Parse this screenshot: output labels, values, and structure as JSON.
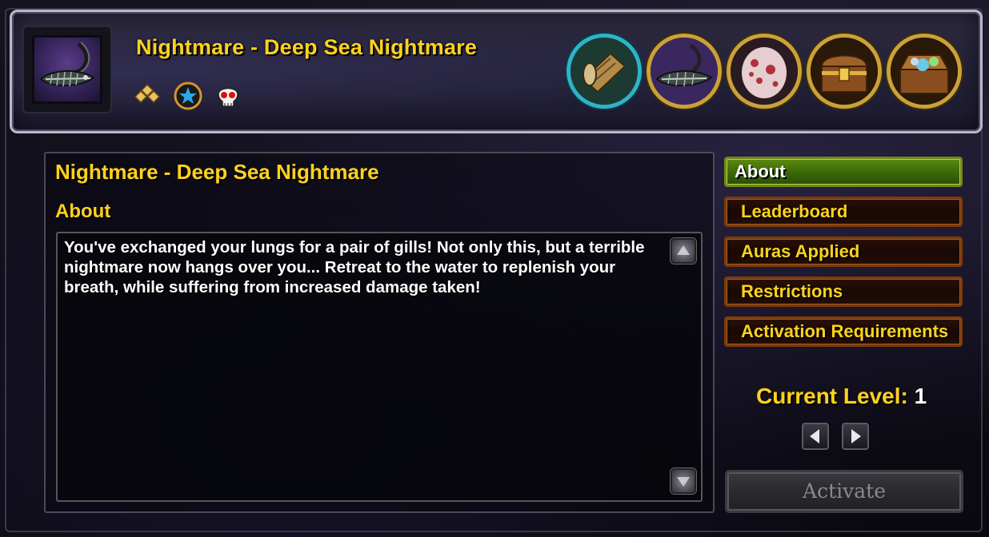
{
  "header": {
    "title": "Nightmare - Deep Sea Nightmare",
    "portrait_icon": "fish-skeleton-icon",
    "badges": [
      "rank-diamonds-icon",
      "blue-star-icon",
      "red-eyed-skull-icon"
    ],
    "abilities": [
      {
        "icon": "scroll-map-icon",
        "style": "teal"
      },
      {
        "icon": "fish-skeleton-icon",
        "style": "gold"
      },
      {
        "icon": "spotted-egg-icon",
        "style": "gold"
      },
      {
        "icon": "treasure-chest-icon",
        "style": "gold"
      },
      {
        "icon": "loot-chest-icon",
        "style": "gold"
      }
    ]
  },
  "main": {
    "title": "Nightmare - Deep Sea Nightmare",
    "section_label": "About",
    "description": "You've exchanged your lungs for a pair of gills! Not only this, but a terrible nightmare now hangs over you... Retreat to the water to replenish your breath, while suffering from increased damage taken!"
  },
  "tabs": [
    {
      "label": "About",
      "active": true
    },
    {
      "label": "Leaderboard",
      "active": false
    },
    {
      "label": "Auras Applied",
      "active": false
    },
    {
      "label": "Restrictions",
      "active": false
    },
    {
      "label": "Activation Requirements",
      "active": false
    }
  ],
  "level": {
    "label": "Current Level:",
    "value": "1"
  },
  "activate_label": "Activate",
  "colors": {
    "title_gold": "#ffd21c",
    "tab_active_green": "#5c8a10",
    "tab_border_brown": "#7a3b0c",
    "header_border": "#b9b8c9"
  }
}
